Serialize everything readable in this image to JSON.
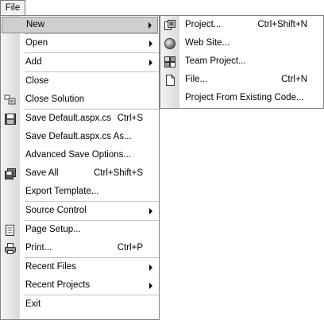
{
  "menubar": {
    "file_label": "File"
  },
  "file_menu": {
    "new": "New",
    "open": "Open",
    "add": "Add",
    "close": "Close",
    "close_solution": "Close Solution",
    "save_file": "Save Default.aspx.cs",
    "save_file_shortcut": "Ctrl+S",
    "save_file_as": "Save Default.aspx.cs As...",
    "advanced_save": "Advanced Save Options...",
    "save_all": "Save All",
    "save_all_shortcut": "Ctrl+Shift+S",
    "export_template": "Export Template...",
    "source_control": "Source Control",
    "page_setup": "Page Setup...",
    "print": "Print...",
    "print_shortcut": "Ctrl+P",
    "recent_files": "Recent Files",
    "recent_projects": "Recent Projects",
    "exit": "Exit"
  },
  "new_submenu": {
    "project": "Project...",
    "project_shortcut": "Ctrl+Shift+N",
    "web_site": "Web Site...",
    "team_project": "Team Project...",
    "file": "File...",
    "file_shortcut": "Ctrl+N",
    "project_from_existing": "Project From Existing Code..."
  },
  "colors": {
    "highlight": "#cfcfcf",
    "border": "#808080",
    "gutter": "#e0e0e0"
  }
}
